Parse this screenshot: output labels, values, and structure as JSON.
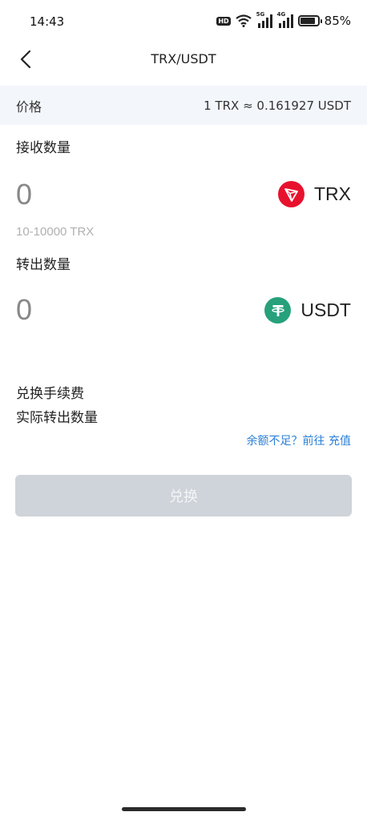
{
  "status_bar": {
    "time": "14:43",
    "hd_label": "HD",
    "net1_label": "5G",
    "net2_label": "4G",
    "battery_percent": "85%",
    "battery_level": 0.85
  },
  "nav": {
    "title": "TRX/USDT"
  },
  "price": {
    "label": "价格",
    "value": "1 TRX ≈ 0.161927 USDT"
  },
  "receive": {
    "label": "接收数量",
    "amount": "0",
    "coin": "TRX",
    "coin_icon": "tron-logo-icon",
    "coin_color": "#e8112d",
    "range_hint": "10-10000 TRX"
  },
  "send": {
    "label": "转出数量",
    "amount": "0",
    "coin": "USDT",
    "coin_icon": "tether-logo-icon",
    "coin_color": "#26a17b"
  },
  "fees": {
    "fee_label": "兑换手续费",
    "actual_label": "实际转出数量"
  },
  "topup": {
    "text": "余额不足？前往 充值"
  },
  "action": {
    "exchange_label": "兑换"
  },
  "colors": {
    "accent_link": "#2b7fd6",
    "button_disabled": "#cfd3da",
    "price_bg": "#f3f6fb"
  }
}
